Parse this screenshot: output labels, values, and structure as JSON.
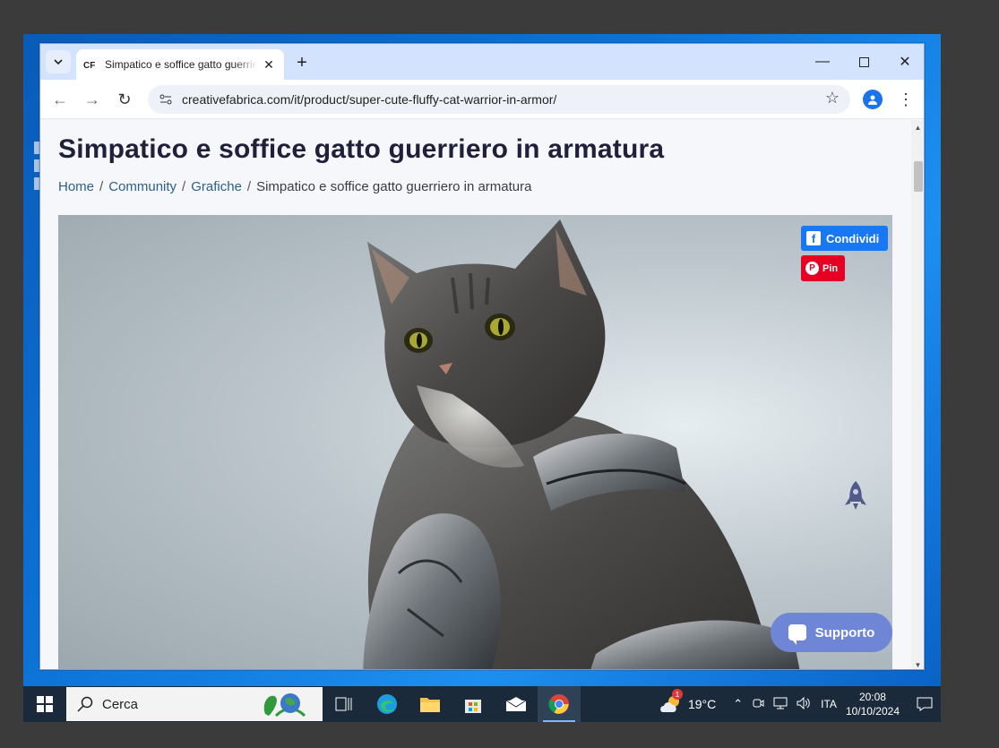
{
  "browser": {
    "tab_title": "Simpatico e soffice gatto guerriero in armatura",
    "tab_favicon": "creativefabrica-icon",
    "url": "creativefabrica.com/it/product/super-cute-fluffy-cat-warrior-in-armor/"
  },
  "page": {
    "title": "Simpatico e soffice gatto guerriero in armatura",
    "breadcrumb": {
      "home": "Home",
      "community": "Community",
      "grafiche": "Grafiche",
      "current": "Simpatico e soffice gatto guerriero in armatura",
      "separator": "/"
    },
    "share_label": "Condividi",
    "pin_label": "Pin",
    "support_label": "Supporto",
    "image_subject": "cat-warrior-in-armor-image"
  },
  "taskbar": {
    "search_label": "Cerca",
    "weather_temp": "19°C",
    "weather_badge": "1",
    "language": "ITA",
    "time": "20:08",
    "date": "10/10/2024"
  },
  "colors": {
    "facebook": "#1877f2",
    "pinterest": "#e60023",
    "support": "#6f86d6",
    "title": "#21203a"
  }
}
